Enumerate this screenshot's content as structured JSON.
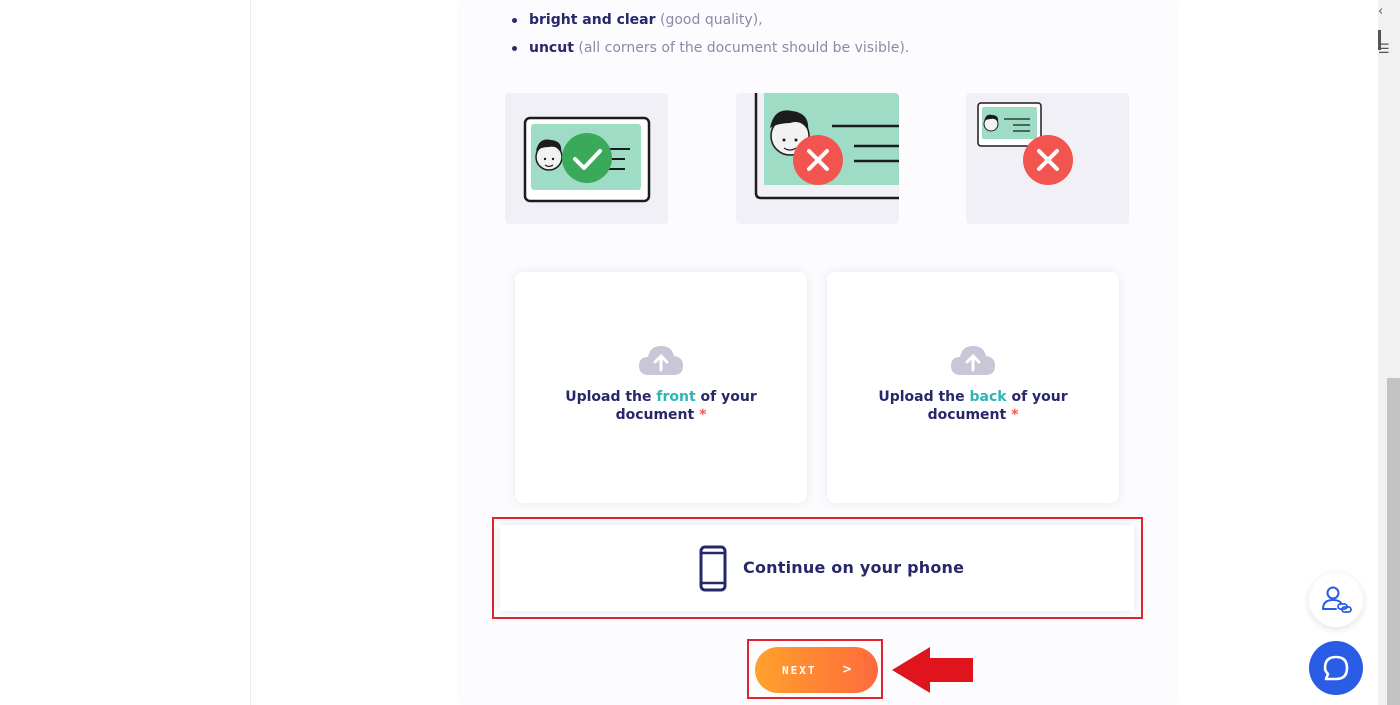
{
  "requirements": [
    {
      "bold": "bright and clear",
      "rest": " (good quality),"
    },
    {
      "bold": "uncut",
      "rest": " (all corners of the document should be visible)."
    }
  ],
  "examples": [
    {
      "name": "good-example",
      "icon": "check-icon",
      "color": "#3aaa5a"
    },
    {
      "name": "cropped-example",
      "icon": "cross-icon",
      "color": "#f2554f"
    },
    {
      "name": "too-small-example",
      "icon": "cross-icon",
      "color": "#f2554f"
    }
  ],
  "upload": {
    "front": {
      "prefix": "Upload the ",
      "accent": "front",
      "suffix": " of your",
      "line2": "document",
      "required": "*"
    },
    "back": {
      "prefix": "Upload the ",
      "accent": "back",
      "suffix": " of your",
      "line2": "document",
      "required": "*"
    }
  },
  "phone_option": {
    "label": "Continue on your phone",
    "icon": "smartphone-icon"
  },
  "next_button": {
    "label": "NEXT",
    "chevron": ">"
  },
  "colors": {
    "primary_text": "#27276a",
    "accent": "#2fb4b6",
    "required": "#ee5a52",
    "highlight": "#e0232c",
    "button_gradient_start": "#ffa12b",
    "button_gradient_end": "#ff6a3d",
    "chat_button": "#2b5ce6"
  },
  "floating_buttons": [
    {
      "name": "profile-link-icon"
    },
    {
      "name": "chat-bubble-icon"
    }
  ]
}
